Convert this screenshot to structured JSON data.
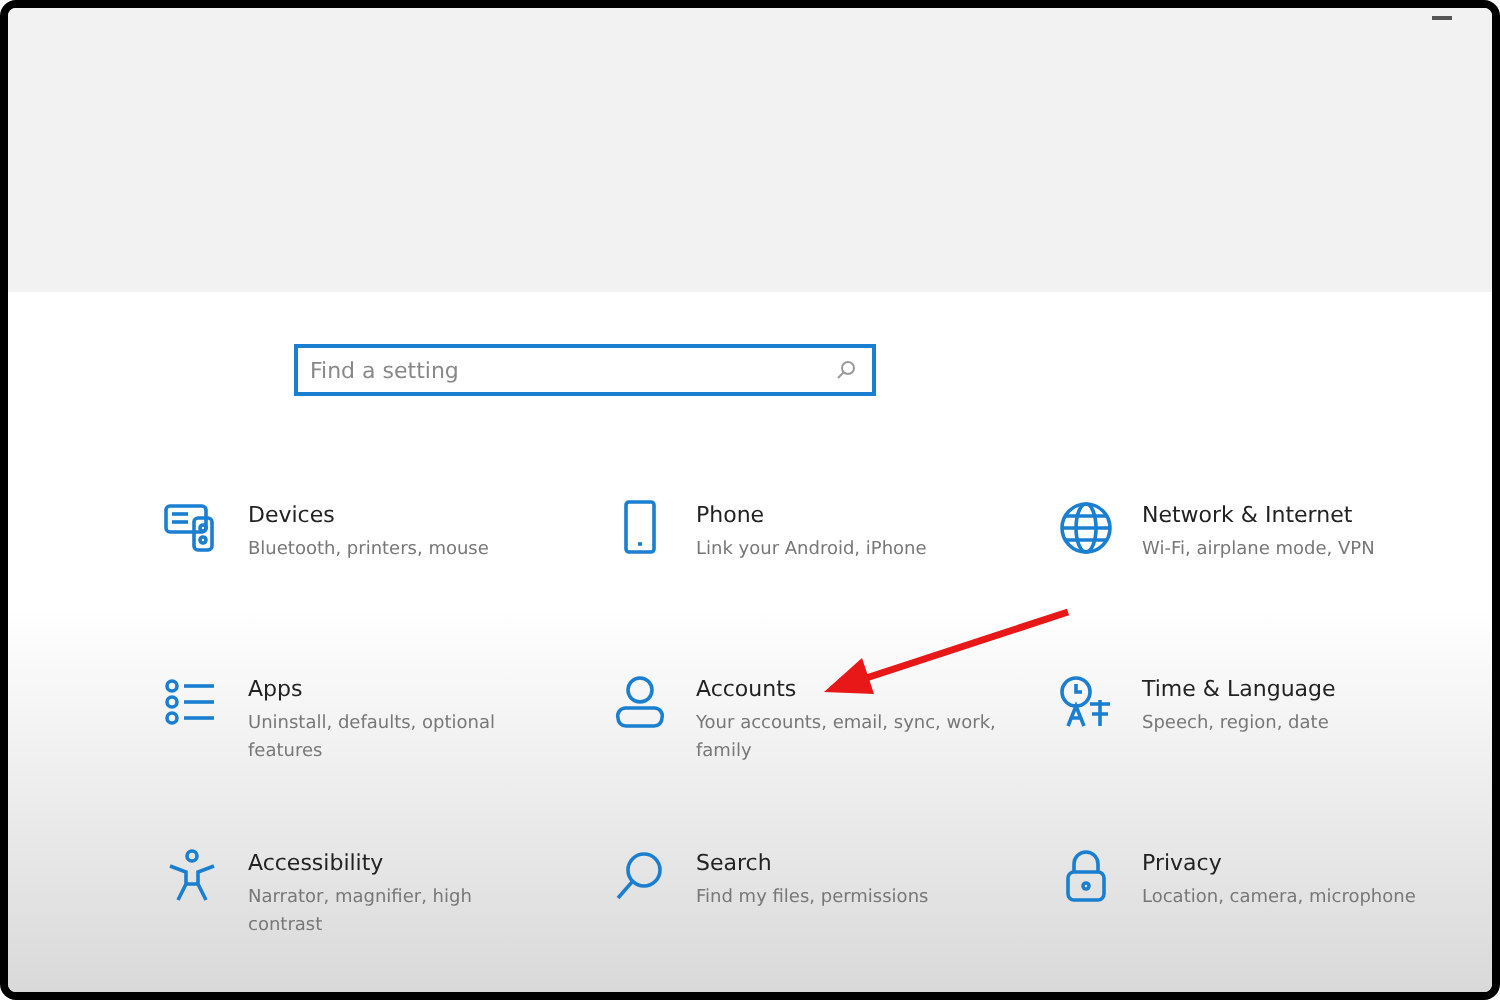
{
  "search": {
    "placeholder": "Find a setting"
  },
  "categories": [
    {
      "kind": "devices",
      "title": "Devices",
      "subtitle": "Bluetooth, printers, mouse"
    },
    {
      "kind": "phone",
      "title": "Phone",
      "subtitle": "Link your Android, iPhone"
    },
    {
      "kind": "network",
      "title": "Network & Internet",
      "subtitle": "Wi-Fi, airplane mode, VPN"
    },
    {
      "kind": "apps",
      "title": "Apps",
      "subtitle": "Uninstall, defaults, optional features"
    },
    {
      "kind": "accounts",
      "title": "Accounts",
      "subtitle": "Your accounts, email, sync, work, family"
    },
    {
      "kind": "time",
      "title": "Time & Language",
      "subtitle": "Speech, region, date"
    },
    {
      "kind": "accessibility",
      "title": "Accessibility",
      "subtitle": "Narrator, magnifier, high contrast"
    },
    {
      "kind": "search",
      "title": "Search",
      "subtitle": "Find my files, permissions"
    },
    {
      "kind": "privacy",
      "title": "Privacy",
      "subtitle": "Location, camera, microphone"
    }
  ]
}
